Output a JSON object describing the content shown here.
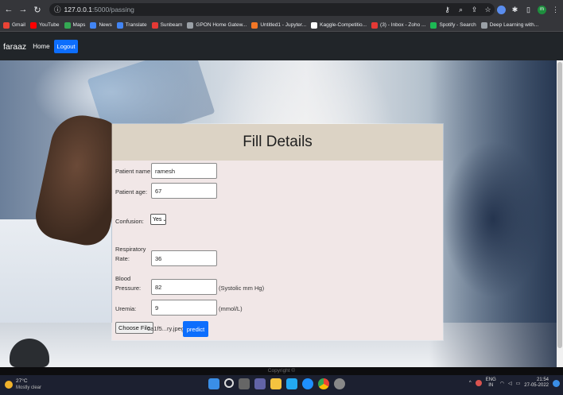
{
  "browser": {
    "url_host": "127.0.0.1",
    "url_path": ":5000/passing",
    "bookmarks": [
      {
        "label": "Gmail",
        "color": "#ea4335"
      },
      {
        "label": "YouTube",
        "color": "#ff0000"
      },
      {
        "label": "Maps",
        "color": "#34a853"
      },
      {
        "label": "News",
        "color": "#4285f4"
      },
      {
        "label": "Translate",
        "color": "#4285f4"
      },
      {
        "label": "Sunbeam",
        "color": "#e53935"
      },
      {
        "label": "GPON Home Gatew...",
        "color": "#9aa0a6"
      },
      {
        "label": "Untitled1 - Jupyter...",
        "color": "#f37726"
      },
      {
        "label": "Kaggle-Competitio...",
        "color": "#ffffff"
      },
      {
        "label": "(3) - Inbox - Zoho ...",
        "color": "#e53935"
      },
      {
        "label": "Spotify - Search",
        "color": "#1db954"
      },
      {
        "label": "Deep Learning with...",
        "color": "#9aa0a6"
      }
    ]
  },
  "navbar": {
    "brand": "faraaz",
    "home": "Home",
    "logout": "Logout"
  },
  "form": {
    "title": "Fill Details",
    "patient_name_label": "Patient name:",
    "patient_name_value": "ramesh",
    "patient_age_label": "Patient age:",
    "patient_age_value": "67",
    "confusion_label": "Confusion:",
    "confusion_value": "Yes",
    "resp_label_1": "Respiratory",
    "resp_label_2": "Rate:",
    "resp_value": "36",
    "bp_label_1": "Blood",
    "bp_label_2": "Pressure:",
    "bp_value": "82",
    "bp_unit": "(Systolic mm Hg)",
    "uremia_label": "Uremia:",
    "uremia_value": "9",
    "uremia_unit": "(mmol/L)",
    "choose_file": "Choose File",
    "file_name": "0a1f5...ry.jpeg",
    "predict": "predict"
  },
  "footer": {
    "copyright": "Copyright ©"
  },
  "taskbar": {
    "temp": "27°C",
    "weather": "Mostly clear",
    "lang_1": "ENG",
    "lang_2": "IN",
    "time": "21:54",
    "date": "27-05-2022"
  }
}
